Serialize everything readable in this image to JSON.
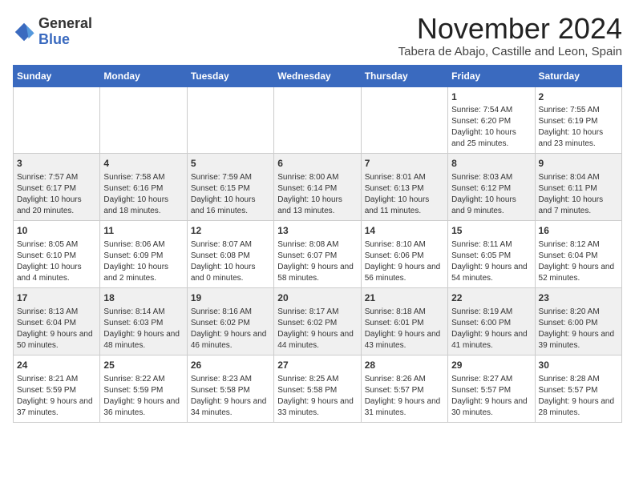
{
  "logo": {
    "general": "General",
    "blue": "Blue"
  },
  "title": "November 2024",
  "subtitle": "Tabera de Abajo, Castille and Leon, Spain",
  "weekdays": [
    "Sunday",
    "Monday",
    "Tuesday",
    "Wednesday",
    "Thursday",
    "Friday",
    "Saturday"
  ],
  "weeks": [
    [
      {
        "day": "",
        "info": ""
      },
      {
        "day": "",
        "info": ""
      },
      {
        "day": "",
        "info": ""
      },
      {
        "day": "",
        "info": ""
      },
      {
        "day": "",
        "info": ""
      },
      {
        "day": "1",
        "info": "Sunrise: 7:54 AM\nSunset: 6:20 PM\nDaylight: 10 hours and 25 minutes."
      },
      {
        "day": "2",
        "info": "Sunrise: 7:55 AM\nSunset: 6:19 PM\nDaylight: 10 hours and 23 minutes."
      }
    ],
    [
      {
        "day": "3",
        "info": "Sunrise: 7:57 AM\nSunset: 6:17 PM\nDaylight: 10 hours and 20 minutes."
      },
      {
        "day": "4",
        "info": "Sunrise: 7:58 AM\nSunset: 6:16 PM\nDaylight: 10 hours and 18 minutes."
      },
      {
        "day": "5",
        "info": "Sunrise: 7:59 AM\nSunset: 6:15 PM\nDaylight: 10 hours and 16 minutes."
      },
      {
        "day": "6",
        "info": "Sunrise: 8:00 AM\nSunset: 6:14 PM\nDaylight: 10 hours and 13 minutes."
      },
      {
        "day": "7",
        "info": "Sunrise: 8:01 AM\nSunset: 6:13 PM\nDaylight: 10 hours and 11 minutes."
      },
      {
        "day": "8",
        "info": "Sunrise: 8:03 AM\nSunset: 6:12 PM\nDaylight: 10 hours and 9 minutes."
      },
      {
        "day": "9",
        "info": "Sunrise: 8:04 AM\nSunset: 6:11 PM\nDaylight: 10 hours and 7 minutes."
      }
    ],
    [
      {
        "day": "10",
        "info": "Sunrise: 8:05 AM\nSunset: 6:10 PM\nDaylight: 10 hours and 4 minutes."
      },
      {
        "day": "11",
        "info": "Sunrise: 8:06 AM\nSunset: 6:09 PM\nDaylight: 10 hours and 2 minutes."
      },
      {
        "day": "12",
        "info": "Sunrise: 8:07 AM\nSunset: 6:08 PM\nDaylight: 10 hours and 0 minutes."
      },
      {
        "day": "13",
        "info": "Sunrise: 8:08 AM\nSunset: 6:07 PM\nDaylight: 9 hours and 58 minutes."
      },
      {
        "day": "14",
        "info": "Sunrise: 8:10 AM\nSunset: 6:06 PM\nDaylight: 9 hours and 56 minutes."
      },
      {
        "day": "15",
        "info": "Sunrise: 8:11 AM\nSunset: 6:05 PM\nDaylight: 9 hours and 54 minutes."
      },
      {
        "day": "16",
        "info": "Sunrise: 8:12 AM\nSunset: 6:04 PM\nDaylight: 9 hours and 52 minutes."
      }
    ],
    [
      {
        "day": "17",
        "info": "Sunrise: 8:13 AM\nSunset: 6:04 PM\nDaylight: 9 hours and 50 minutes."
      },
      {
        "day": "18",
        "info": "Sunrise: 8:14 AM\nSunset: 6:03 PM\nDaylight: 9 hours and 48 minutes."
      },
      {
        "day": "19",
        "info": "Sunrise: 8:16 AM\nSunset: 6:02 PM\nDaylight: 9 hours and 46 minutes."
      },
      {
        "day": "20",
        "info": "Sunrise: 8:17 AM\nSunset: 6:02 PM\nDaylight: 9 hours and 44 minutes."
      },
      {
        "day": "21",
        "info": "Sunrise: 8:18 AM\nSunset: 6:01 PM\nDaylight: 9 hours and 43 minutes."
      },
      {
        "day": "22",
        "info": "Sunrise: 8:19 AM\nSunset: 6:00 PM\nDaylight: 9 hours and 41 minutes."
      },
      {
        "day": "23",
        "info": "Sunrise: 8:20 AM\nSunset: 6:00 PM\nDaylight: 9 hours and 39 minutes."
      }
    ],
    [
      {
        "day": "24",
        "info": "Sunrise: 8:21 AM\nSunset: 5:59 PM\nDaylight: 9 hours and 37 minutes."
      },
      {
        "day": "25",
        "info": "Sunrise: 8:22 AM\nSunset: 5:59 PM\nDaylight: 9 hours and 36 minutes."
      },
      {
        "day": "26",
        "info": "Sunrise: 8:23 AM\nSunset: 5:58 PM\nDaylight: 9 hours and 34 minutes."
      },
      {
        "day": "27",
        "info": "Sunrise: 8:25 AM\nSunset: 5:58 PM\nDaylight: 9 hours and 33 minutes."
      },
      {
        "day": "28",
        "info": "Sunrise: 8:26 AM\nSunset: 5:57 PM\nDaylight: 9 hours and 31 minutes."
      },
      {
        "day": "29",
        "info": "Sunrise: 8:27 AM\nSunset: 5:57 PM\nDaylight: 9 hours and 30 minutes."
      },
      {
        "day": "30",
        "info": "Sunrise: 8:28 AM\nSunset: 5:57 PM\nDaylight: 9 hours and 28 minutes."
      }
    ]
  ]
}
